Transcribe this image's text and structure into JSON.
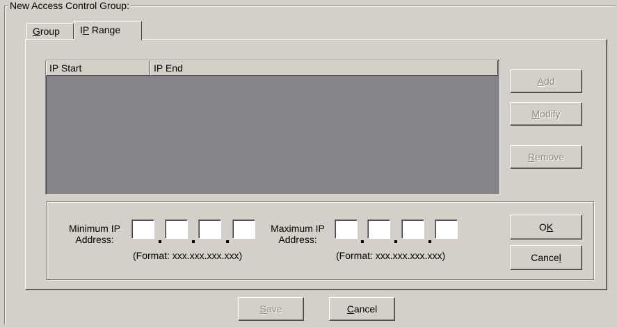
{
  "group_box": {
    "title": "New Access Control Group:"
  },
  "tabs": [
    {
      "mnemonic": "G",
      "rest": "roup",
      "active": false
    },
    {
      "pre": "I",
      "mnemonic": "P",
      "rest": " Range",
      "active": true
    }
  ],
  "list": {
    "columns": [
      "IP Start",
      "IP End"
    ],
    "rows": []
  },
  "side_buttons": {
    "add": {
      "mnemonic": "A",
      "rest": "dd",
      "enabled": false
    },
    "modify": {
      "mnemonic": "M",
      "rest": "odify",
      "enabled": false
    },
    "remove": {
      "mnemonic": "R",
      "rest": "emove",
      "enabled": false
    }
  },
  "ip_entry": {
    "min_label_line1": "Minimum IP",
    "min_label_line2": "Address:",
    "max_label_line1": "Maximum IP",
    "max_label_line2": "Address:",
    "format_hint": "(Format: xxx.xxx.xxx.xxx)",
    "min_octets": [
      "",
      "",
      "",
      ""
    ],
    "max_octets": [
      "",
      "",
      "",
      ""
    ]
  },
  "dialog_buttons": {
    "ok": {
      "pre": "O",
      "mnemonic": "K"
    },
    "cancel": {
      "pre": "Cance",
      "mnemonic": "l"
    }
  },
  "footer_buttons": {
    "save": {
      "mnemonic": "S",
      "rest": "ave",
      "enabled": false
    },
    "cancel": {
      "mnemonic": "C",
      "rest": "ancel",
      "enabled": true
    }
  }
}
